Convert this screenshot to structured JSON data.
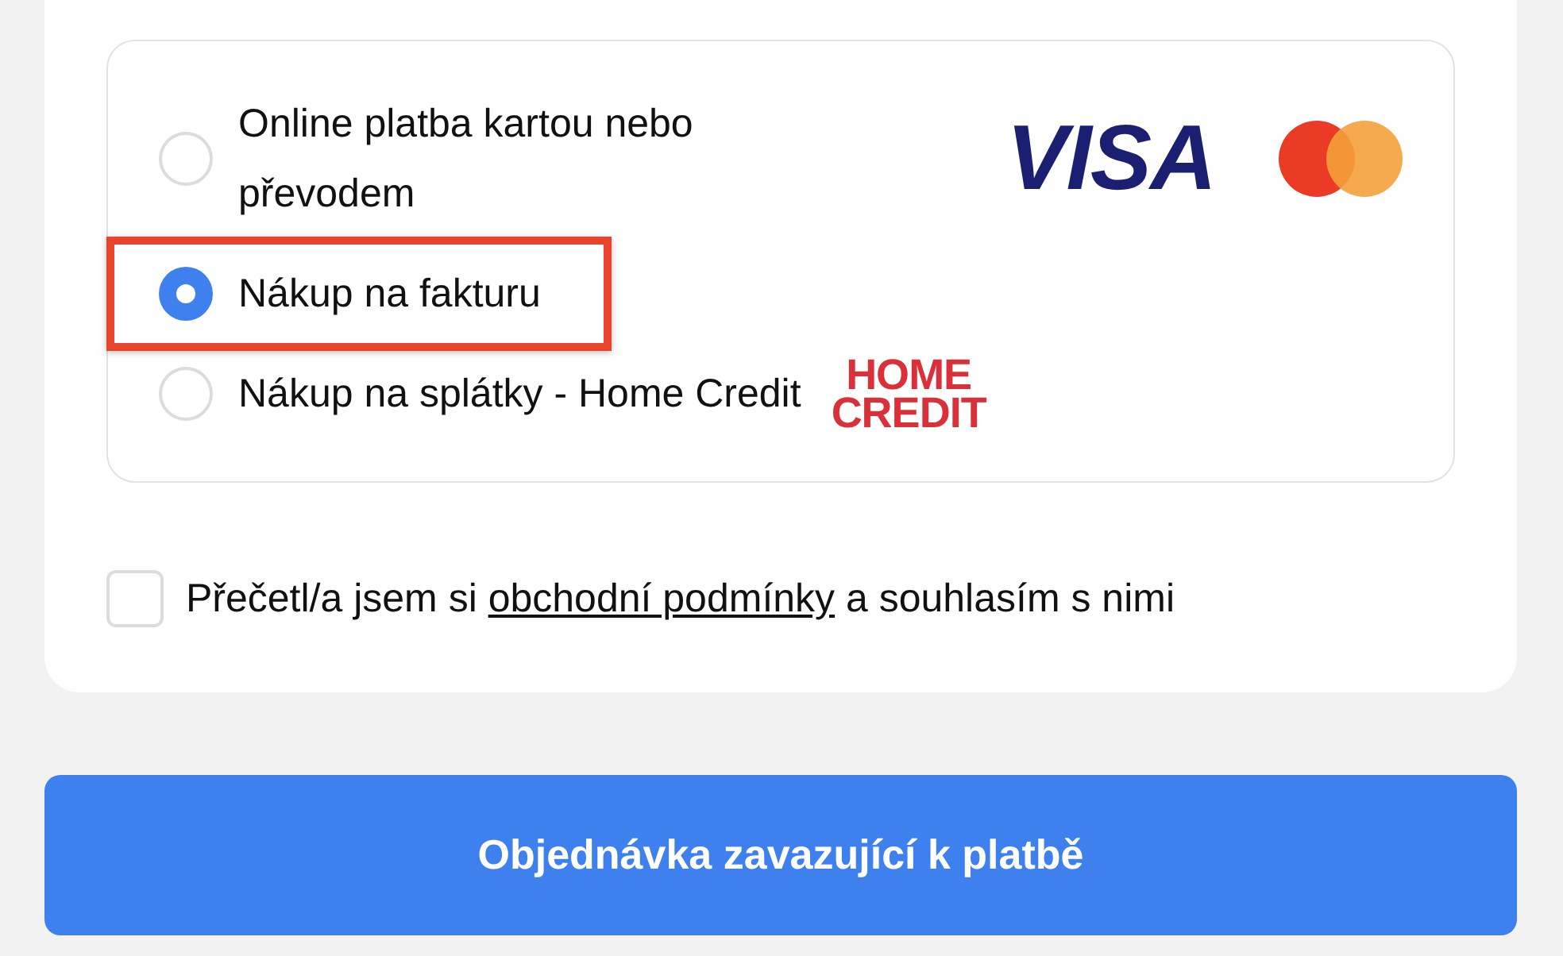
{
  "payment_options": [
    {
      "label": "Online platba kartou nebo převodem",
      "selected": false,
      "highlighted": false,
      "logos": [
        {
          "kind": "visa",
          "text": "VISA"
        },
        {
          "kind": "mastercard"
        }
      ]
    },
    {
      "label": "Nákup na fakturu",
      "selected": true,
      "highlighted": true
    },
    {
      "label": "Nákup na splátky - Home Credit",
      "selected": false,
      "highlighted": false,
      "logos": [
        {
          "kind": "homecredit",
          "lines": [
            "HOME",
            "CREDIT"
          ]
        }
      ]
    }
  ],
  "terms": {
    "checked": false,
    "before": "Přečetl/a jsem si ",
    "link": "obchodní podmínky",
    "after": " a souhlasím s nimi"
  },
  "submit_button": "Objednávka zavazující k platbě"
}
